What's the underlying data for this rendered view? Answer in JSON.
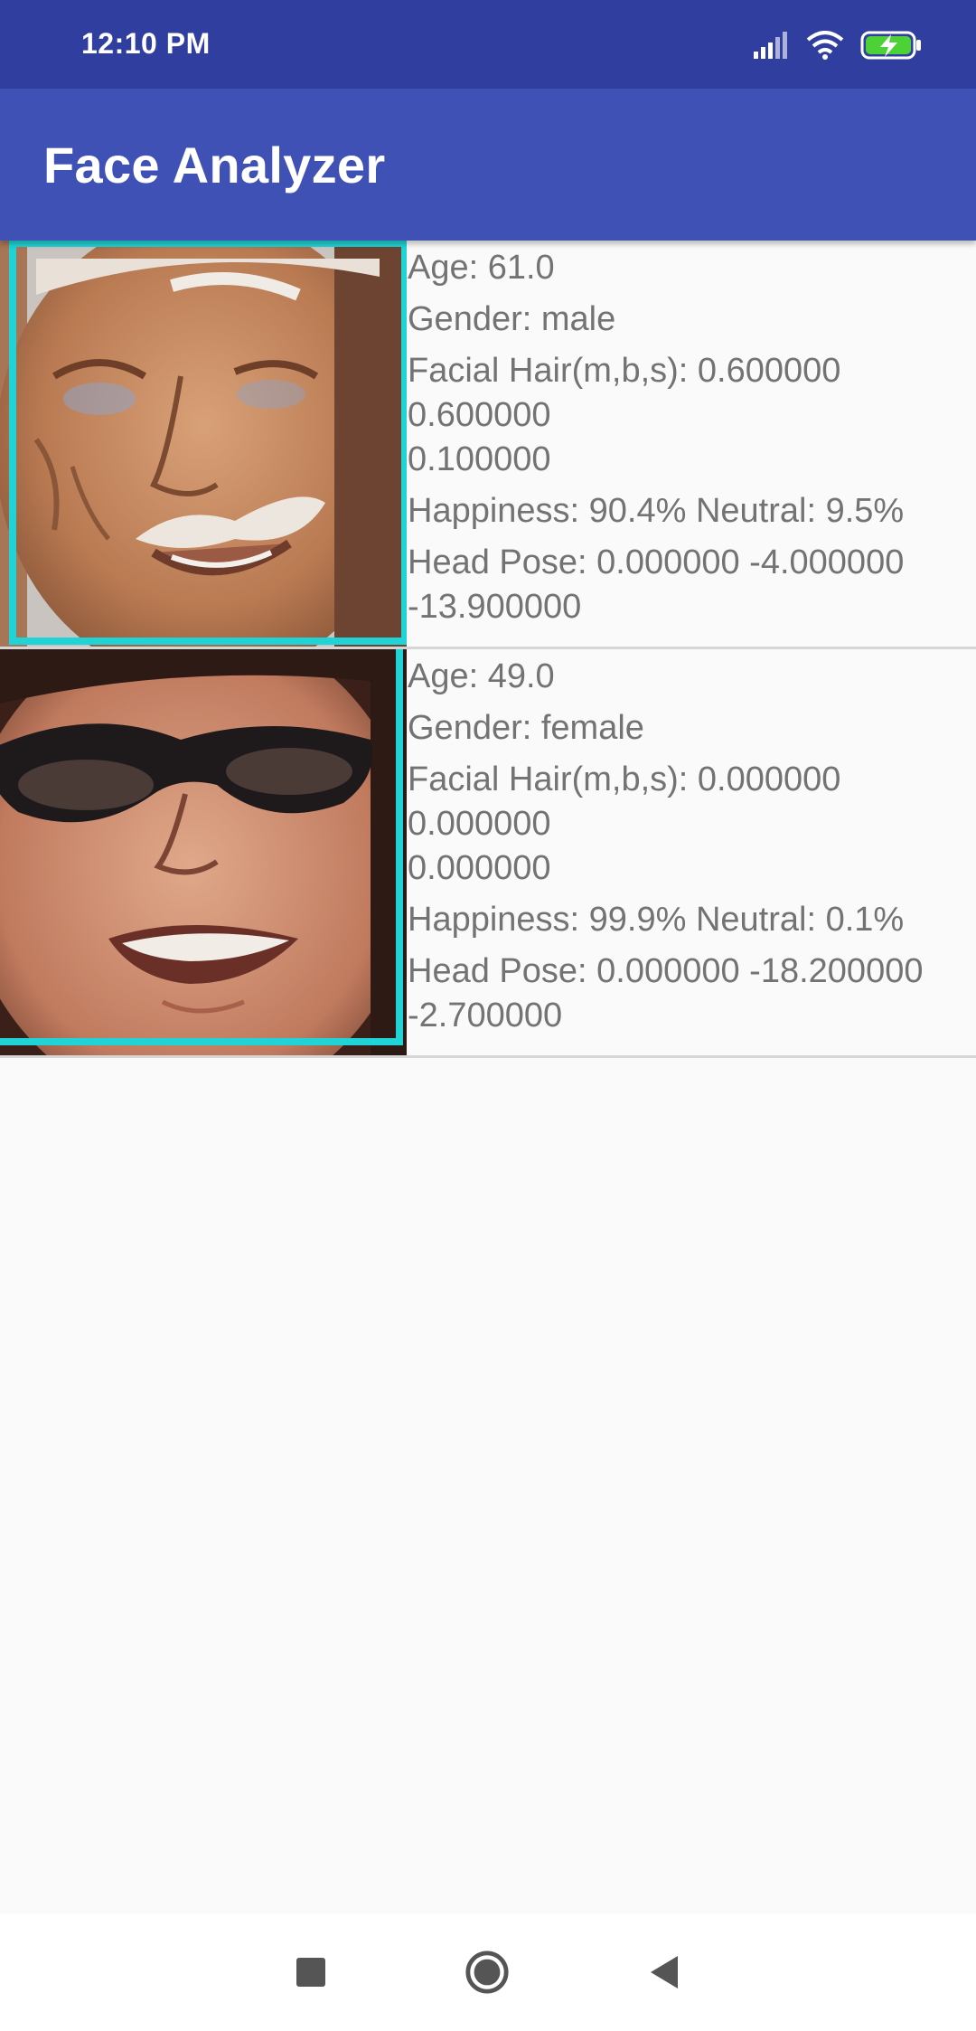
{
  "status_bar": {
    "time": "12:10 PM",
    "icons": [
      "signal-icon",
      "wifi-icon",
      "battery-charging-icon"
    ]
  },
  "app_bar": {
    "title": "Face Analyzer",
    "background": "#3f51b5",
    "status_background": "#303f9f"
  },
  "faces": [
    {
      "age": "Age: 61.0",
      "gender": "Gender: male",
      "facial_hair": [
        "Facial Hair(m,b,s): 0.600000",
        "0.600000",
        "0.100000"
      ],
      "emotion": "Happiness: 90.4% Neutral: 9.5%",
      "head_pose": [
        "Head Pose: 0.000000 -4.000000",
        "-13.900000"
      ]
    },
    {
      "age": "Age: 49.0",
      "gender": "Gender: female",
      "facial_hair": [
        "Facial Hair(m,b,s): 0.000000",
        "0.000000",
        "0.000000"
      ],
      "emotion": "Happiness: 99.9% Neutral: 0.1%",
      "head_pose": [
        "Head Pose: 0.000000 -18.200000",
        "-2.700000"
      ]
    }
  ],
  "colors": {
    "face_box": "#1fd3d6",
    "info_text": "#737373",
    "divider": "#d6d6d6"
  },
  "nav_bar": {
    "buttons": [
      "recent-apps-button",
      "home-button",
      "back-button"
    ]
  }
}
